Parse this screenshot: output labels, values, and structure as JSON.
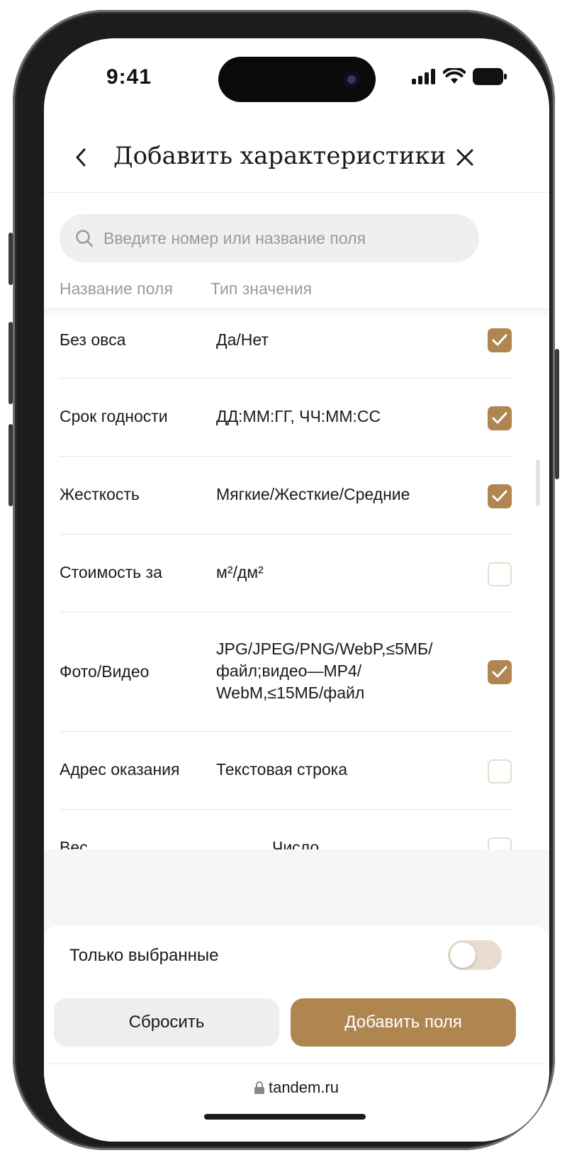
{
  "status_bar": {
    "time": "9:41"
  },
  "header": {
    "title": "Добавить характеристики"
  },
  "search": {
    "placeholder": "Введите номер или название поля"
  },
  "columns": {
    "name": "Название поля",
    "type": "Тип значения"
  },
  "rows": [
    {
      "name": "Без овса",
      "type": "Да/Нет",
      "checked": true
    },
    {
      "name": "Срок годности",
      "type": "ДД:ММ:ГГ, ЧЧ:ММ:СС",
      "checked": true
    },
    {
      "name": "Жесткость",
      "type": "Мягкие/Жесткие/Средние",
      "checked": true
    },
    {
      "name": "Стоимость за",
      "type": "м²/дм²",
      "checked": false
    },
    {
      "name": "Фото/Видео",
      "type": "JPG/JPEG/PNG/WebP,≤5МБ/ файл;видео—MP4/ WebM,≤15МБ/файл",
      "checked": true
    },
    {
      "name": "Адрес оказания",
      "type": "Текстовая строка",
      "checked": false
    },
    {
      "name": "Вес",
      "type": "Число",
      "checked": false
    }
  ],
  "filter": {
    "label": "Только выбранные",
    "on": false
  },
  "actions": {
    "reset_label": "Сбросить",
    "add_label": "Добавить поля"
  },
  "browser": {
    "url": "tandem.ru"
  },
  "colors": {
    "accent": "#b08650",
    "toggle_off": "#e7dccd",
    "button_secondary": "#efeeec"
  }
}
